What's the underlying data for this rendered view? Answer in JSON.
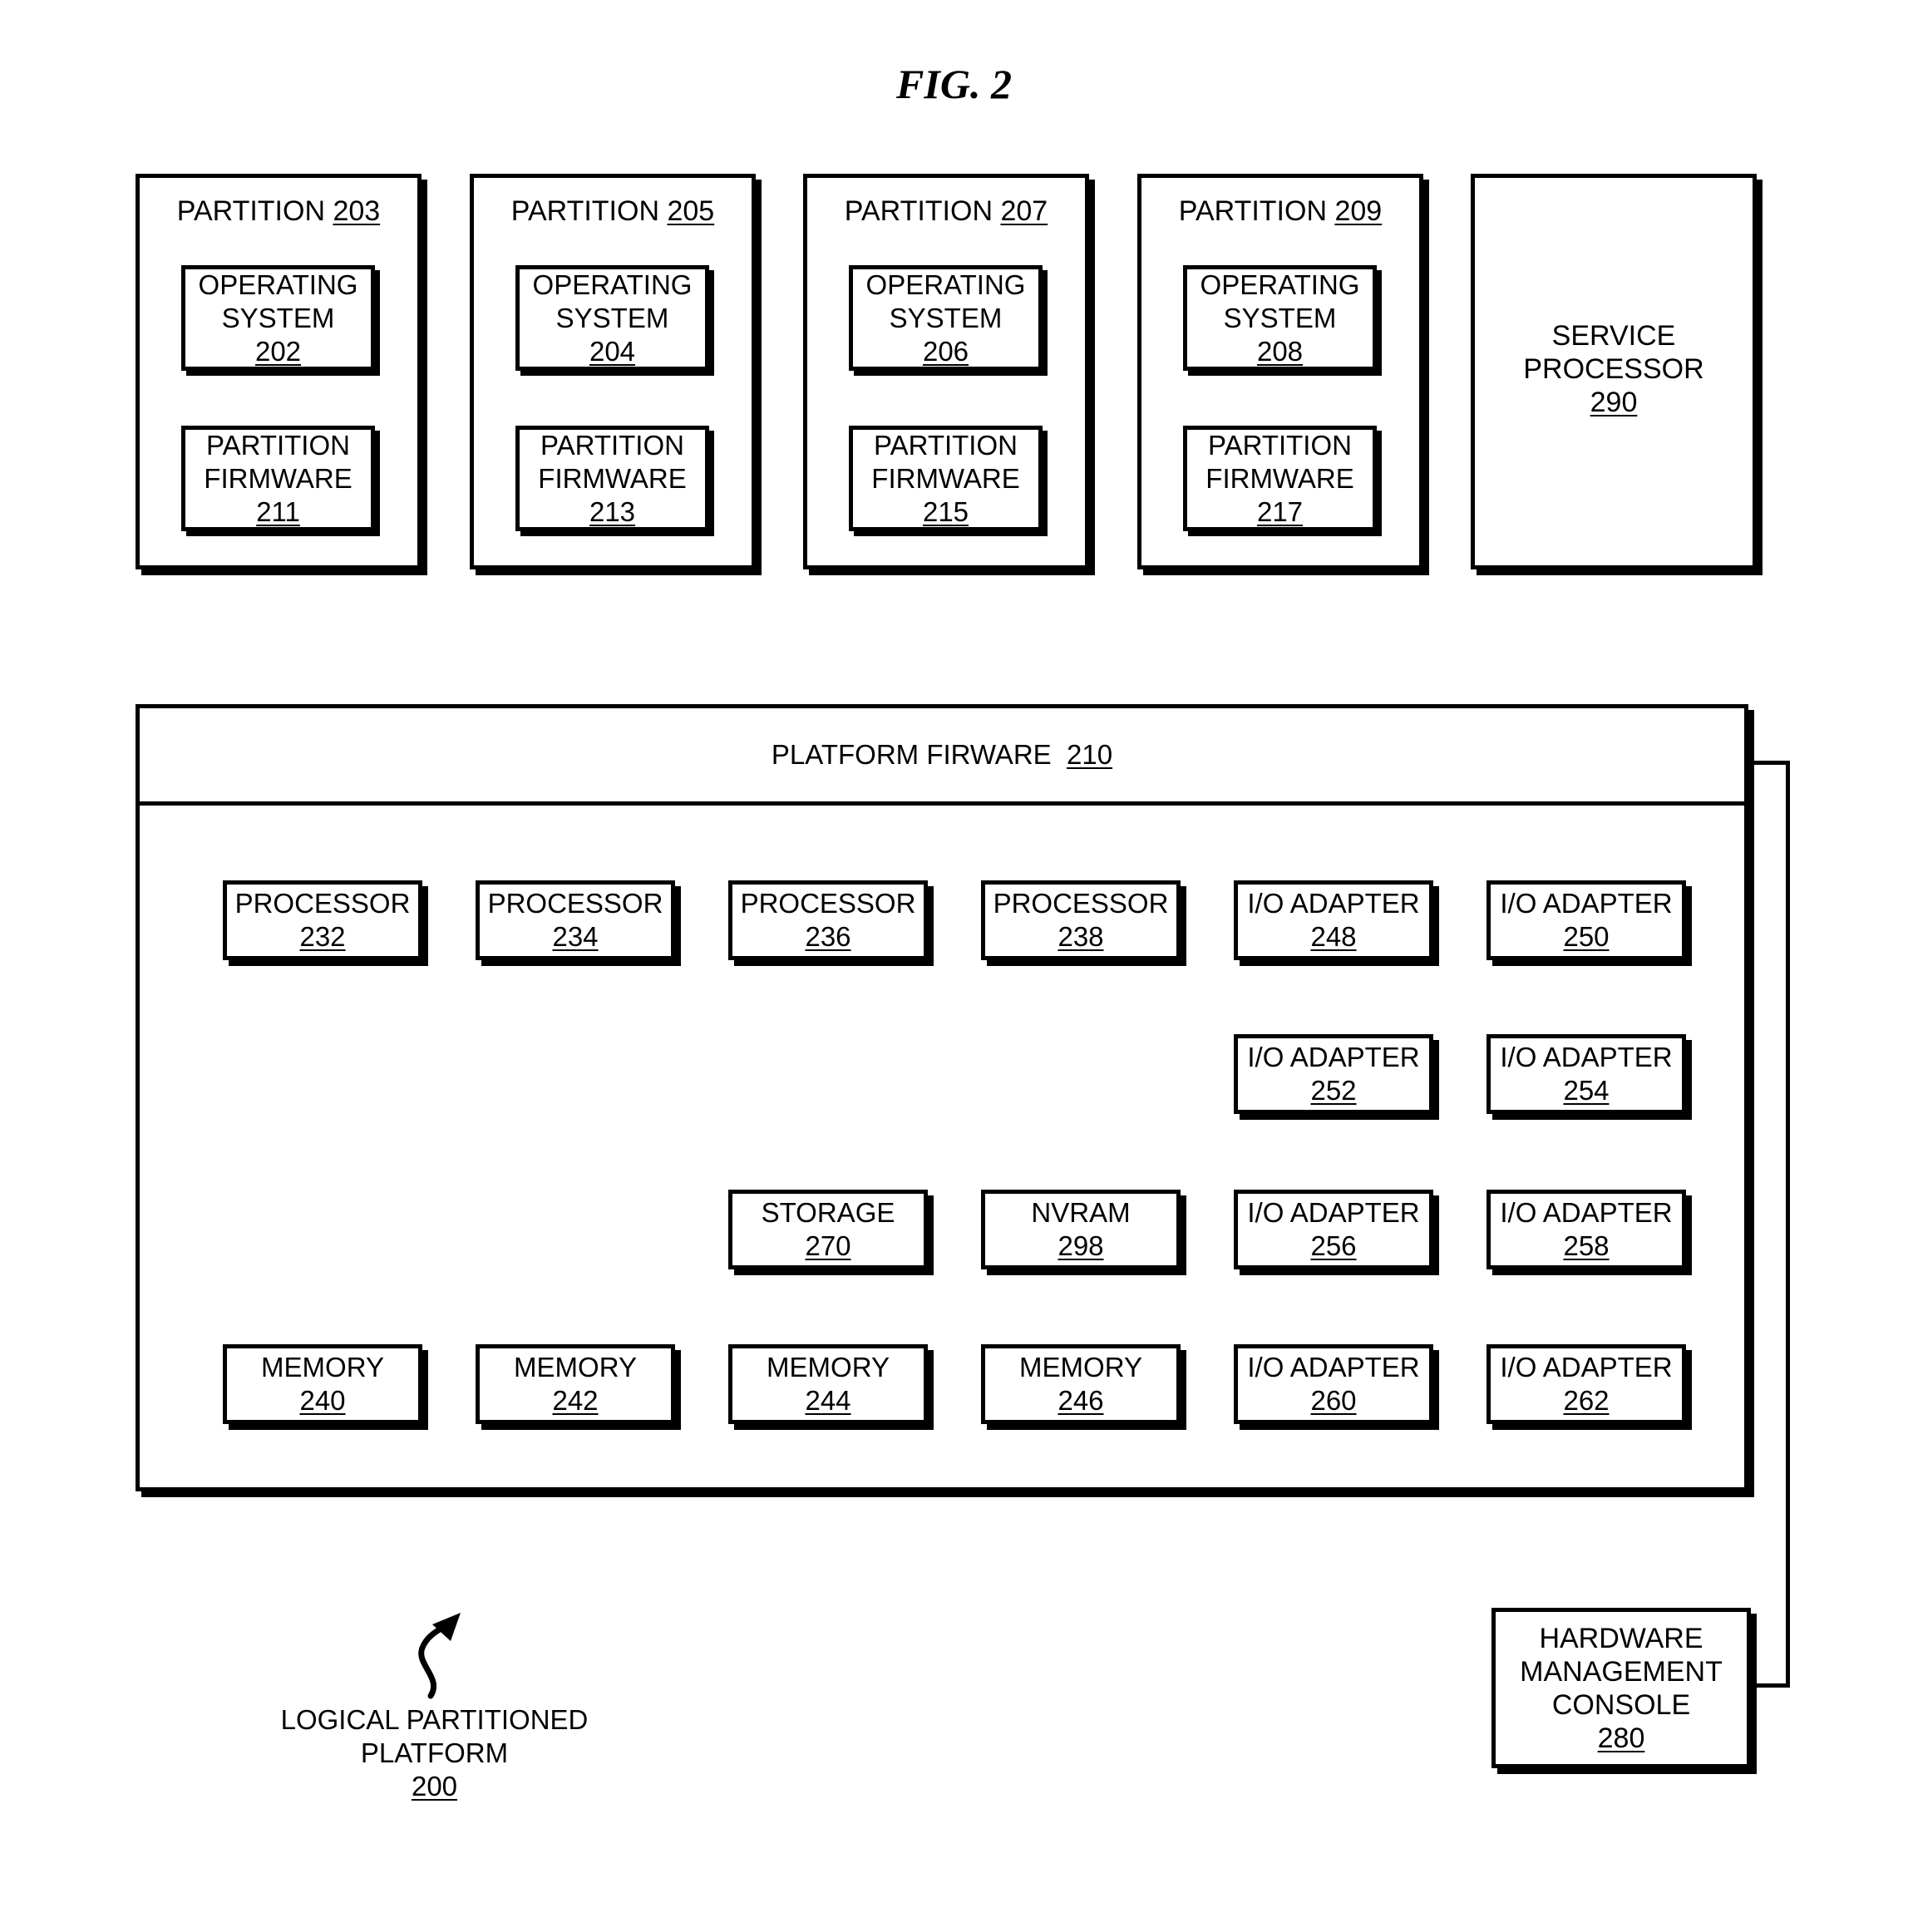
{
  "figure_title": "FIG. 2",
  "partitions": [
    {
      "label": "PARTITION",
      "ref": "203",
      "os": {
        "lines": [
          "OPERATING",
          "SYSTEM"
        ],
        "ref": "202"
      },
      "firmware": {
        "lines": [
          "PARTITION",
          "FIRMWARE"
        ],
        "ref": "211"
      }
    },
    {
      "label": "PARTITION",
      "ref": "205",
      "os": {
        "lines": [
          "OPERATING",
          "SYSTEM"
        ],
        "ref": "204"
      },
      "firmware": {
        "lines": [
          "PARTITION",
          "FIRMWARE"
        ],
        "ref": "213"
      }
    },
    {
      "label": "PARTITION",
      "ref": "207",
      "os": {
        "lines": [
          "OPERATING",
          "SYSTEM"
        ],
        "ref": "206"
      },
      "firmware": {
        "lines": [
          "PARTITION",
          "FIRMWARE"
        ],
        "ref": "215"
      }
    },
    {
      "label": "PARTITION",
      "ref": "209",
      "os": {
        "lines": [
          "OPERATING",
          "SYSTEM"
        ],
        "ref": "208"
      },
      "firmware": {
        "lines": [
          "PARTITION",
          "FIRMWARE"
        ],
        "ref": "217"
      }
    }
  ],
  "service_processor": {
    "lines": [
      "SERVICE",
      "PROCESSOR"
    ],
    "ref": "290"
  },
  "platform_firmware": {
    "label": "PLATFORM FIRWARE",
    "ref": "210"
  },
  "hardware_rows": [
    [
      {
        "label": "PROCESSOR",
        "ref": "232",
        "kind": "processor"
      },
      {
        "label": "PROCESSOR",
        "ref": "234",
        "kind": "processor"
      },
      {
        "label": "PROCESSOR",
        "ref": "236",
        "kind": "processor"
      },
      {
        "label": "PROCESSOR",
        "ref": "238",
        "kind": "processor"
      },
      {
        "label": "I/O ADAPTER",
        "ref": "248",
        "kind": "io-adapter"
      },
      {
        "label": "I/O ADAPTER",
        "ref": "250",
        "kind": "io-adapter"
      }
    ],
    [
      null,
      null,
      null,
      null,
      {
        "label": "I/O ADAPTER",
        "ref": "252",
        "kind": "io-adapter"
      },
      {
        "label": "I/O ADAPTER",
        "ref": "254",
        "kind": "io-adapter"
      }
    ],
    [
      null,
      null,
      {
        "label": "STORAGE",
        "ref": "270",
        "kind": "storage"
      },
      {
        "label": "NVRAM",
        "ref": "298",
        "kind": "nvram"
      },
      {
        "label": "I/O ADAPTER",
        "ref": "256",
        "kind": "io-adapter"
      },
      {
        "label": "I/O ADAPTER",
        "ref": "258",
        "kind": "io-adapter"
      }
    ],
    [
      {
        "label": "MEMORY",
        "ref": "240",
        "kind": "memory"
      },
      {
        "label": "MEMORY",
        "ref": "242",
        "kind": "memory"
      },
      {
        "label": "MEMORY",
        "ref": "244",
        "kind": "memory"
      },
      {
        "label": "MEMORY",
        "ref": "246",
        "kind": "memory"
      },
      {
        "label": "I/O ADAPTER",
        "ref": "260",
        "kind": "io-adapter"
      },
      {
        "label": "I/O ADAPTER",
        "ref": "262",
        "kind": "io-adapter"
      }
    ]
  ],
  "hardware_management_console": {
    "lines": [
      "HARDWARE",
      "MANAGEMENT",
      "CONSOLE"
    ],
    "ref": "280"
  },
  "platform_label": {
    "lines": [
      "LOGICAL PARTITIONED",
      "PLATFORM"
    ],
    "ref": "200"
  }
}
